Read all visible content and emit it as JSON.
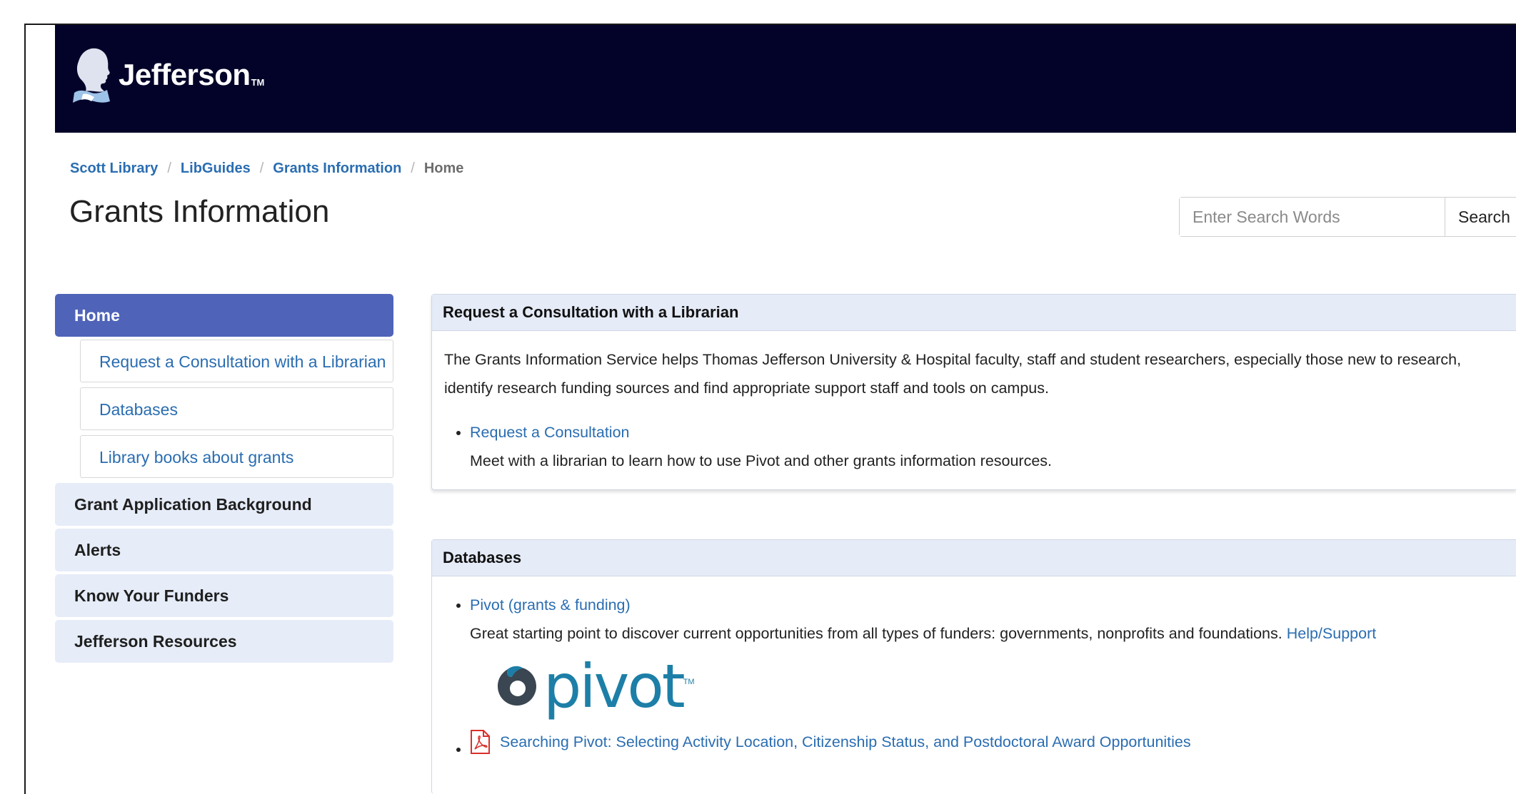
{
  "header": {
    "logo_text": "Jefferson",
    "logo_tm": "TM"
  },
  "breadcrumb": {
    "items": [
      "Scott Library",
      "LibGuides",
      "Grants Information"
    ],
    "current": "Home",
    "separator": "/"
  },
  "page_title": "Grants Information",
  "search": {
    "placeholder": "Enter Search Words",
    "button_label": "Search"
  },
  "sidenav": {
    "home": "Home",
    "subitems": [
      "Request a Consultation with a Librarian",
      "Databases",
      "Library books about grants"
    ],
    "items": [
      "Grant Application Background",
      "Alerts",
      "Know Your Funders",
      "Jefferson Resources"
    ]
  },
  "consult_panel": {
    "heading": "Request a Consultation with a Librarian",
    "intro": "The Grants Information Service helps Thomas Jefferson University & Hospital faculty, staff and student researchers, especially those new to research, identify research funding sources and find appropriate support staff and tools on campus.",
    "link": "Request a Consultation",
    "link_desc": "Meet with a librarian to learn how to use Pivot and other grants information resources."
  },
  "databases_panel": {
    "heading": "Databases",
    "link": "Pivot (grants & funding)",
    "link_desc": "Great starting point to discover current opportunities from all types of funders: governments, nonprofits and foundations.",
    "help_link": "Help/Support",
    "logo_text": "pivot",
    "logo_tm": "TM",
    "pdf_link": "Searching Pivot: Selecting Activity Location, Citizenship Status, and Postdoctoral Award Opportunities",
    "pdf_icon": "pdf-icon"
  },
  "colors": {
    "header_bg": "#03032a",
    "nav_active": "#4f63b8",
    "nav_bg": "#e6ecf8",
    "link": "#2a6db1",
    "panel_heading_bg": "#e5ebf7"
  }
}
